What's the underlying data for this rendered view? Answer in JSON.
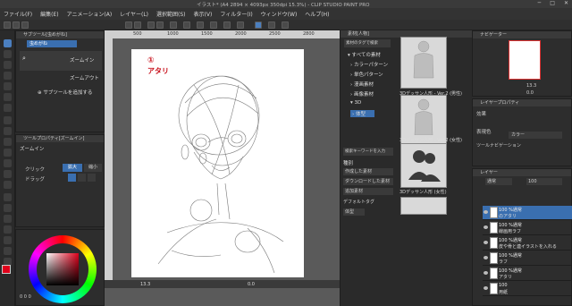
{
  "window": {
    "title": "イラスト* (A4 2894 × 4093px 350dpi 15.3%) - CLIP STUDIO PAINT PRO",
    "controls": [
      "─",
      "□",
      "✕"
    ]
  },
  "menu": [
    "ファイル(F)",
    "編集(E)",
    "アニメーション(A)",
    "レイヤー(L)",
    "選択範囲(S)",
    "表示(V)",
    "フィルター(I)",
    "ウィンドウ(W)",
    "ヘルプ(H)"
  ],
  "subtool_panel": {
    "header": "サブツール[虫めがね]",
    "tabs": [
      "虫めがね"
    ],
    "items": [
      "ズームイン",
      "ズームアウト"
    ],
    "add_label": "サブツールを追加する"
  },
  "tool_property": {
    "header": "ツールプロパティ[ズームイン]",
    "title": "ズームイン",
    "click_label": "クリック",
    "click_options": [
      "拡大",
      "縮小"
    ],
    "drag_label": "ドラッグ"
  },
  "color": {
    "main": "#e0001b",
    "sub": "#ffffff",
    "readouts": [
      "0",
      "0",
      "0"
    ]
  },
  "canvas": {
    "annotation_number": "①",
    "annotation_text": "アタリ",
    "annotation_color": "#c8101b",
    "ruler_marks": [
      "500",
      "1000",
      "1500",
      "2000",
      "2500",
      "2800"
    ],
    "zoom": "13.3",
    "status_items": [
      "13.3",
      "0.0"
    ]
  },
  "material_panel": {
    "header": "素材[人物]",
    "search_hint": "素材のタグで検索",
    "tree": [
      {
        "label": "すべての素材",
        "arrow": "▾"
      },
      {
        "label": "カラーパターン",
        "arrow": "›"
      },
      {
        "label": "単色パターン",
        "arrow": "›"
      },
      {
        "label": "漫画素材",
        "arrow": "›"
      },
      {
        "label": "画像素材",
        "arrow": "›"
      },
      {
        "label": "3D",
        "arrow": "▾"
      },
      {
        "label": "体型",
        "arrow": "›"
      }
    ],
    "tag_search_label": "検索キーワードを入力",
    "tags_header": "種別",
    "tags": [
      "作成した素材",
      "ダウンロードした素材",
      "追加素材"
    ],
    "default_tag_label": "デフォルトタグ",
    "default_tag": "体型",
    "thumbnails": [
      "3Dデッサン人形 - Ver.2 (男性)",
      "3Dデッサン人形 - Ver.2 (女性)",
      "3Dデッサン人形 (女性)"
    ]
  },
  "navigator": {
    "header": "ナビゲーター",
    "zoom": "13.3",
    "angle": "0.0"
  },
  "layer_property": {
    "header": "レイヤープロパティ",
    "effect_label": "効果",
    "expression_label": "表現色",
    "expression_value": "カラー",
    "tool_navigation": "ツールナビゲーション"
  },
  "layers_panel": {
    "header": "レイヤー",
    "blend_mode": "通常",
    "opacity": "100",
    "layers": [
      {
        "opacity": "100 %通常",
        "name": "のアタリ",
        "selected": true
      },
      {
        "opacity": "100 %通常",
        "name": "線画用ラフ",
        "selected": false
      },
      {
        "opacity": "100 %通常",
        "name": "皮や骨と連イラストを入れる",
        "selected": false
      },
      {
        "opacity": "100 %通常",
        "name": "ラフ",
        "selected": false
      },
      {
        "opacity": "100 %通常",
        "name": "アタリ",
        "selected": false
      },
      {
        "opacity": "100",
        "name": "用紙",
        "selected": false
      }
    ]
  }
}
